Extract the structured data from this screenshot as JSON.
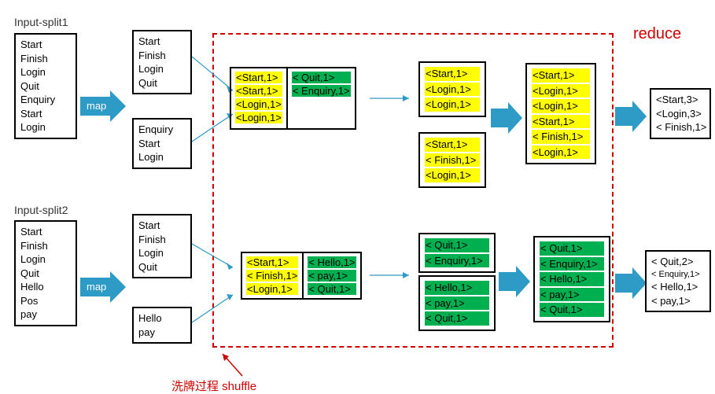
{
  "labels": {
    "split1": "Input-split1",
    "split2": "Input-split2",
    "reduce": "reduce",
    "shuffle": "洗牌过程  shuffle",
    "map": "map"
  },
  "input1": [
    "Start",
    "Finish",
    "Login",
    "Quit",
    "Enquiry",
    "Start",
    "Login"
  ],
  "input2": [
    "Start",
    "Finish",
    "Login",
    "Quit",
    "Hello",
    "Pos",
    "pay"
  ],
  "split1a": [
    "Start",
    "Finish",
    "Login",
    "Quit"
  ],
  "split1b": [
    "Enquiry",
    "Start",
    "Login"
  ],
  "split2a": [
    "Start",
    "Finish",
    "Login",
    "Quit"
  ],
  "split2b": [
    "Hello",
    "pay"
  ],
  "map1_yellow": [
    "<Start,1>",
    "<Start,1>",
    "<Login,1>",
    "<Login,1>"
  ],
  "map1_green": [
    "< Quit,1>",
    "< Enquiry,1>"
  ],
  "map2_yellow": [
    "<Start,1>",
    "< Finish,1>",
    "<Login,1>"
  ],
  "map2_green": [
    "< Hello,1>",
    "< pay,1>",
    "< Quit,1>"
  ],
  "combine1a": [
    "<Start,1>",
    "<Login,1>",
    "<Login,1>"
  ],
  "combine1b": [
    "<Start,1>",
    "< Finish,1>",
    "<Login,1>"
  ],
  "combine2a": [
    "< Quit,1>",
    "< Enquiry,1>"
  ],
  "combine2b": [
    "< Hello,1>",
    "< pay,1>",
    "< Quit,1>"
  ],
  "merged1": [
    "<Start,1>",
    "<Login,1>",
    "<Login,1>",
    "<Start,1>",
    "< Finish,1>",
    "<Login,1>"
  ],
  "merged2": [
    "< Quit,1>",
    "< Enquiry,1>",
    "< Hello,1>",
    "< pay,1>",
    "< Quit,1>"
  ],
  "out1": [
    "<Start,3>",
    "<Login,3>",
    "< Finish,1>"
  ],
  "out2": [
    "< Quit,2>",
    "< Enquiry,1>",
    "< Hello,1>",
    "< pay,1>"
  ],
  "chart_data": {
    "type": "table",
    "title": "MapReduce word-count shuffle/reduce illustration",
    "stages": [
      "input",
      "map",
      "shuffle",
      "reduce"
    ],
    "final_counts": [
      {
        "key": "Start",
        "count": 3
      },
      {
        "key": "Login",
        "count": 3
      },
      {
        "key": "Finish",
        "count": 1
      },
      {
        "key": "Quit",
        "count": 2
      },
      {
        "key": "Enquiry",
        "count": 1
      },
      {
        "key": "Hello",
        "count": 1
      },
      {
        "key": "pay",
        "count": 1
      }
    ]
  }
}
